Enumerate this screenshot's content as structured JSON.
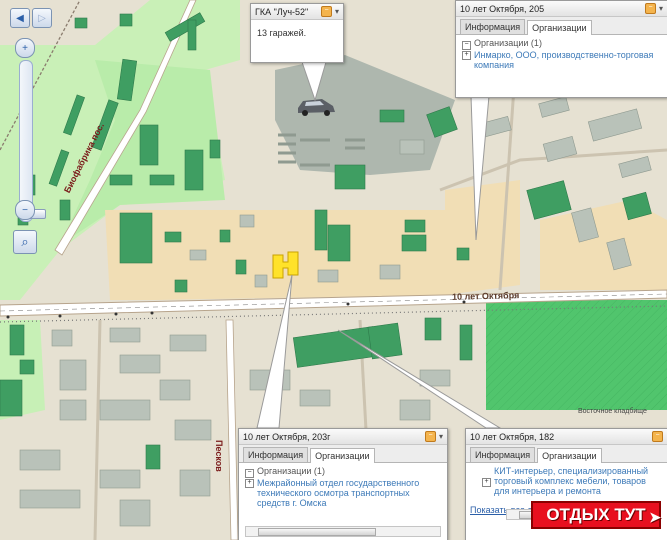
{
  "street_labels": {
    "main": "10 лет Октября",
    "diagonal": "Биофабрика пос.",
    "vertical": "Песков",
    "cemetery": "Восточное кладбище"
  },
  "popups": {
    "top": {
      "title": "ГКА \"Луч-52\"",
      "body": "13 гаражей."
    },
    "right": {
      "title": "10 лет Октября, 205",
      "tab_info": "Информация",
      "tab_orgs": "Организации",
      "root": "Организации (1)",
      "item": "Инмарко, ООО, производственно-торговая компания"
    },
    "bottom_left": {
      "title": "10 лет Октября, 203г",
      "tab_info": "Информация",
      "tab_orgs": "Организации",
      "root": "Организации (1)",
      "item": "Межрайонный отдел государственного технического осмотра транспортных средств г. Омска"
    },
    "bottom_right": {
      "title": "10 лет Октября, 182",
      "tab_info": "Информация",
      "tab_orgs": "Организации",
      "item": "КИТ-интерьер, специализированный торговый комплекс мебели, товаров для интерьера и ремонта",
      "show_all": "Показать все о"
    }
  },
  "promo": "ОТДЫХ ТУТ"
}
